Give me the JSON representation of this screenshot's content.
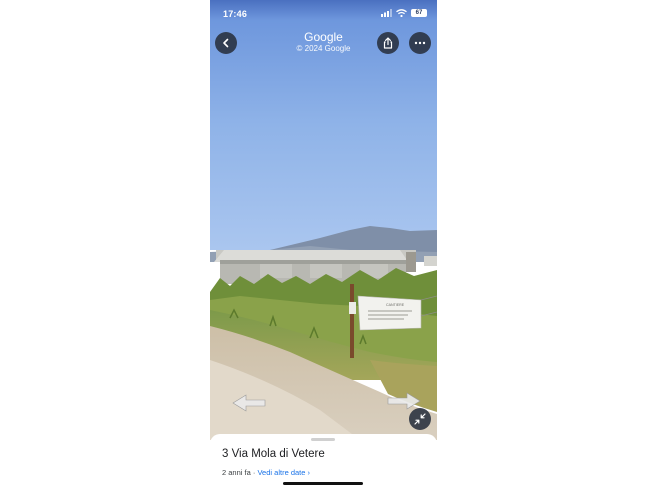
{
  "status_bar": {
    "time": "17:46",
    "battery": "67"
  },
  "header": {
    "title": "Google",
    "subtitle": "© 2024 Google"
  },
  "scene": {
    "sign_text": "CANTIERE"
  },
  "bottom_sheet": {
    "address": "3 Via Mola di Vetere",
    "date_age": "2 anni fa",
    "separator": "·",
    "more_dates_label": "Vedi altre date",
    "chevron": "›"
  },
  "icons": {
    "back": "chevron-left-icon",
    "share": "share-icon",
    "more": "more-horizontal-icon",
    "exit_fullscreen": "collapse-icon",
    "location": "location-arrow-icon",
    "signal": "signal-icon",
    "wifi": "wifi-icon",
    "battery": "battery-icon"
  },
  "colors": {
    "link": "#1a73e8",
    "sky": "#8fb3e8",
    "button_bg": "#28303e"
  }
}
